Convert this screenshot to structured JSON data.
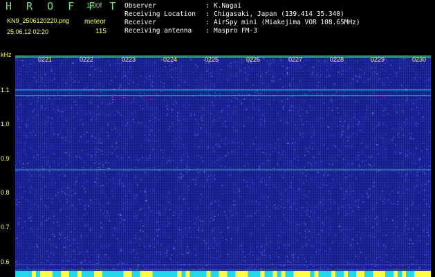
{
  "header": {
    "app_title": "H R O F F T",
    "version": "1.00f",
    "file_name": "KN9_2506120220.png",
    "mode": "meteor",
    "timestamp": "25.06.12 02:20",
    "count": "115"
  },
  "metadata": [
    {
      "key": "Observer",
      "sep": ":",
      "value": "K.Nagai"
    },
    {
      "key": "Receiving Location",
      "sep": ":",
      "value": "Chigasaki, Japan (139.414 35.340)"
    },
    {
      "key": "Receiver",
      "sep": ":",
      "value": "AirSpy mini (Miakejima VOR 108.65MHz)"
    },
    {
      "key": "Receiving antenna",
      "sep": ":",
      "value": "Maspro FM-3"
    }
  ],
  "spectrogram": {
    "y_unit": "kHz",
    "y_ticks": [
      "1.1",
      "1.0",
      "0.9",
      "0.8",
      "0.7",
      "0.6"
    ],
    "x_ticks": [
      "0221",
      "0222",
      "0223",
      "0224",
      "0225",
      "0226",
      "0227",
      "0228",
      "0229",
      "0230"
    ],
    "background_color": "#141c8c",
    "trace_color": "#3fd0c0",
    "marker_color": "#ffff66",
    "y_range": [
      0.58,
      1.19
    ],
    "traces_khz": [
      1.095,
      1.08,
      0.875,
      0.615,
      0.6
    ]
  }
}
